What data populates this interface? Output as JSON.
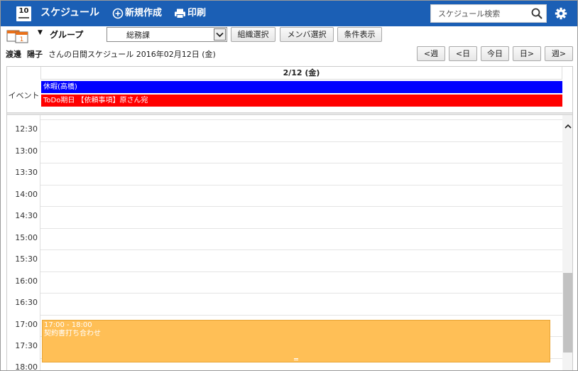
{
  "header": {
    "app_icon_number": "10",
    "title": "スケジュール",
    "new_label": "新規作成",
    "print_label": "印刷",
    "search_placeholder": "スケジュール検索",
    "accent_color": "#1b5fb5"
  },
  "group_bar": {
    "label": "グループ",
    "selected_group": "総務課",
    "org_select_label": "組織選択",
    "member_select_label": "メンバ選択",
    "condition_label": "条件表示"
  },
  "owner": {
    "last_name": "渡邊",
    "first_name": "陽子",
    "heading": "さんの日間スケジュール 2016年02月12日 (金)"
  },
  "nav": {
    "prev_week": "<週",
    "prev_day": "<日",
    "today": "今日",
    "next_day": "日>",
    "next_week": "週>"
  },
  "calendar": {
    "date_header": "2/12 (金)",
    "event_label": "イベント",
    "events": [
      {
        "title": "休暇(高橋)",
        "color": "#0000ff"
      },
      {
        "title": "ToDo期日 【依頼事項】原さん宛",
        "color": "#ff0000"
      }
    ],
    "time_slots": [
      "12:30",
      "13:00",
      "13:30",
      "14:00",
      "14:30",
      "15:00",
      "15:30",
      "16:00",
      "16:30",
      "17:00",
      "17:30",
      "18:00"
    ],
    "appointment": {
      "time": "17:00 - 18:00",
      "title": "契約書打ち合わせ",
      "color": "#ffbf56"
    }
  }
}
